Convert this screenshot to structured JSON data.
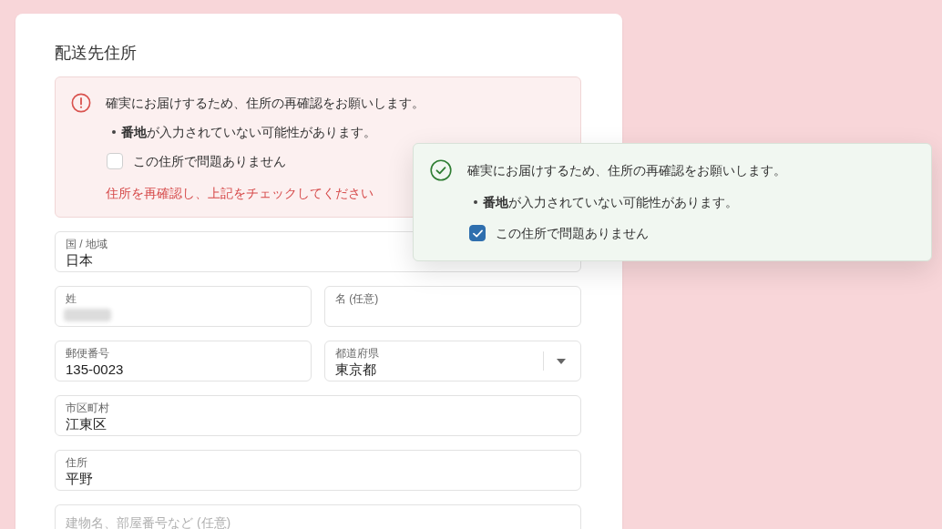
{
  "section_title": "配送先住所",
  "alerts": [
    {
      "kind": "error",
      "message": "確実にお届けするため、住所の再確認をお願いします。",
      "issues": [
        "**番地**が入力されていない可能性があります。"
      ],
      "confirm": {
        "label": "この住所で問題ありません",
        "checked": false
      },
      "error_text": "住所を再確認し、上記をチェックしてください"
    },
    {
      "kind": "success",
      "message": "確実にお届けするため、住所の再確認をお願いします。",
      "issues": [
        "**番地**が入力されていない可能性があります。"
      ],
      "confirm": {
        "label": "この住所で問題ありません",
        "checked": true
      }
    }
  ],
  "form_rows": [
    [
      {
        "kind": "text",
        "label": "国 / 地域",
        "value": "日本"
      }
    ],
    [
      {
        "kind": "text",
        "label": "姓",
        "redacted": true
      },
      {
        "kind": "text",
        "label": "名 (任意)"
      }
    ],
    [
      {
        "kind": "text",
        "label": "郵便番号",
        "value": "135-0023"
      },
      {
        "kind": "select",
        "label": "都道府県",
        "value": "東京都"
      }
    ],
    [
      {
        "kind": "text",
        "label": "市区町村",
        "value": "江東区"
      }
    ],
    [
      {
        "kind": "text",
        "label": "住所",
        "value": "平野"
      }
    ],
    [
      {
        "kind": "text",
        "placeholder": "建物名、部屋番号など (任意)"
      }
    ]
  ]
}
